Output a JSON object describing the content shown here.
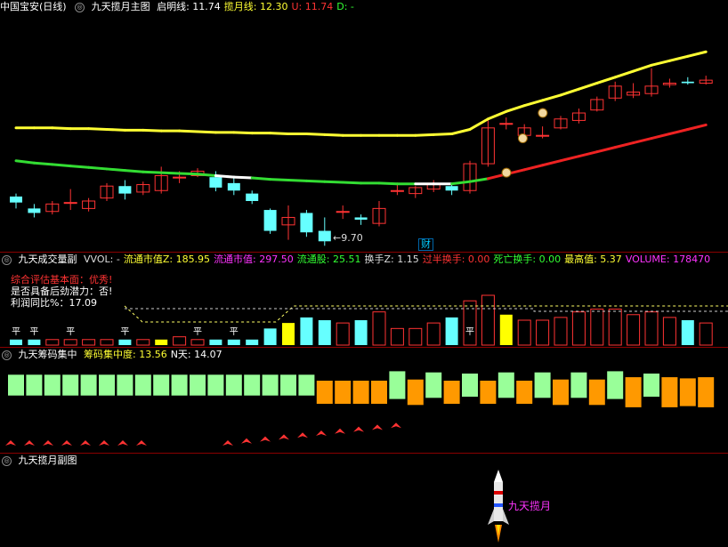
{
  "main": {
    "title": "中国宝安(日线)",
    "indicator": "九天揽月主图",
    "fields": [
      {
        "label": "启明线:",
        "value": "11.74",
        "color": "#ffffff"
      },
      {
        "label": "揽月线:",
        "value": "12.30",
        "color": "#ffff33"
      },
      {
        "label": "U:",
        "value": "11.74",
        "color": "#ff3333"
      },
      {
        "label": "D:",
        "value": "-",
        "color": "#33ff33"
      }
    ],
    "low_label": "9.70",
    "cai_label": "财"
  },
  "vol": {
    "indicator": "九天成交量副",
    "fields": [
      {
        "label": "VVOL:",
        "value": "-",
        "color": "#dddddd"
      },
      {
        "label": "流通市值Z:",
        "value": "185.95",
        "color": "#ffff33"
      },
      {
        "label": "流通市值:",
        "value": "297.50",
        "color": "#ff33ff"
      },
      {
        "label": "流通股:",
        "value": "25.51",
        "color": "#33ff33"
      },
      {
        "label": "换手Z:",
        "value": "1.15",
        "color": "#dddddd"
      },
      {
        "label": "过半换手:",
        "value": "0.00",
        "color": "#ff3333"
      },
      {
        "label": "死亡换手:",
        "value": "0.00",
        "color": "#33ff33"
      },
      {
        "label": "最高值:",
        "value": "5.37",
        "color": "#ffff33"
      },
      {
        "label": "VOLUME:",
        "value": "178470",
        "color": "#ff33ff"
      }
    ],
    "notes": [
      {
        "text": "综合评估基本面：优秀!",
        "color": "#ff3333"
      },
      {
        "text": "是否具备后劲潜力：否!",
        "color": "#ffffff"
      },
      {
        "text": "利润同比%：17.09",
        "color": "#ffffff"
      }
    ],
    "ping": "平"
  },
  "chip": {
    "indicator": "九天筹码集中",
    "fields": [
      {
        "label": "筹码集中度:",
        "value": "13.56",
        "color": "#ffff33"
      },
      {
        "label": "N天:",
        "value": "14.07",
        "color": "#ffffff"
      }
    ]
  },
  "moon": {
    "indicator": "九天揽月副图",
    "rocket_label": "九天揽月"
  },
  "chart_data": {
    "type": "candlestick",
    "candles": [
      [
        11.48,
        11.4,
        11.52,
        11.32
      ],
      [
        11.32,
        11.26,
        11.38,
        11.2
      ],
      [
        11.28,
        11.38,
        11.42,
        11.24
      ],
      [
        11.4,
        11.4,
        11.58,
        11.3
      ],
      [
        11.32,
        11.42,
        11.46,
        11.28
      ],
      [
        11.46,
        11.62,
        11.66,
        11.42
      ],
      [
        11.62,
        11.52,
        11.7,
        11.44
      ],
      [
        11.54,
        11.64,
        11.68,
        11.5
      ],
      [
        11.56,
        11.76,
        11.88,
        11.52
      ],
      [
        11.74,
        11.74,
        11.82,
        11.66
      ],
      [
        11.76,
        11.82,
        11.86,
        11.74
      ],
      [
        11.74,
        11.6,
        11.82,
        11.55
      ],
      [
        11.66,
        11.56,
        11.74,
        11.5
      ],
      [
        11.52,
        11.42,
        11.56,
        11.38
      ],
      [
        11.3,
        11.02,
        11.32,
        10.98
      ],
      [
        11.1,
        11.2,
        11.36,
        10.9
      ],
      [
        11.26,
        11.0,
        11.3,
        10.94
      ],
      [
        11.02,
        10.88,
        11.2,
        10.82
      ],
      [
        11.28,
        11.28,
        11.36,
        11.18
      ],
      [
        11.2,
        11.17,
        11.24,
        11.1
      ],
      [
        11.12,
        11.32,
        11.42,
        11.08
      ],
      [
        11.56,
        11.56,
        11.66,
        11.5
      ],
      [
        11.52,
        11.6,
        11.62,
        11.46
      ],
      [
        11.58,
        11.64,
        11.7,
        11.54
      ],
      [
        11.62,
        11.56,
        11.66,
        11.5
      ],
      [
        11.56,
        11.92,
        11.96,
        11.52
      ],
      [
        11.92,
        12.4,
        12.5,
        11.88
      ],
      [
        12.46,
        12.46,
        12.54,
        12.38
      ],
      [
        12.3,
        12.4,
        12.45,
        12.28
      ],
      [
        12.3,
        12.3,
        12.42,
        12.26
      ],
      [
        12.4,
        12.52,
        12.56,
        12.38
      ],
      [
        12.5,
        12.6,
        12.66,
        12.46
      ],
      [
        12.64,
        12.78,
        12.82,
        12.62
      ],
      [
        12.8,
        12.96,
        13.02,
        12.76
      ],
      [
        12.84,
        12.88,
        13.0,
        12.8
      ],
      [
        12.86,
        12.96,
        13.2,
        12.82
      ],
      [
        12.98,
        13.0,
        13.06,
        12.94
      ],
      [
        13.02,
        13.0,
        13.08,
        12.98
      ],
      [
        13.0,
        13.04,
        13.1,
        12.98
      ]
    ],
    "qiming_line": [
      12.4,
      12.4,
      12.4,
      12.39,
      12.39,
      12.38,
      12.37,
      12.37,
      12.36,
      12.36,
      12.35,
      12.34,
      12.34,
      12.33,
      12.33,
      12.32,
      12.32,
      12.31,
      12.3,
      12.3,
      12.3,
      12.3,
      12.3,
      12.31,
      12.32,
      12.38,
      12.52,
      12.62,
      12.7,
      12.77,
      12.84,
      12.92,
      13.0,
      13.08,
      13.16,
      13.24,
      13.3,
      13.36,
      13.42
    ],
    "lanyue_line": [
      11.96,
      11.93,
      11.91,
      11.89,
      11.87,
      11.85,
      11.83,
      11.81,
      11.8,
      11.79,
      11.78,
      11.76,
      11.74,
      11.73,
      11.71,
      11.7,
      11.69,
      11.68,
      11.67,
      11.66,
      11.66,
      11.65,
      11.65,
      11.65,
      11.65,
      11.68,
      11.72,
      11.78,
      11.84,
      11.9,
      11.96,
      12.02,
      12.08,
      12.14,
      12.2,
      12.26,
      12.32,
      12.38,
      12.44
    ],
    "volume": [
      2,
      2,
      2,
      2,
      2,
      2,
      2,
      2,
      2,
      3,
      2,
      2,
      2,
      2,
      6,
      8,
      10,
      9,
      8,
      9,
      12,
      6,
      6,
      8,
      10,
      16,
      18,
      11,
      9,
      9,
      10,
      12,
      13,
      13,
      11,
      12,
      10,
      9,
      8
    ],
    "chip_concentration": [
      0.9,
      0.9,
      0.9,
      0.9,
      0.9,
      0.9,
      0.9,
      0.9,
      0.9,
      0.9,
      0.9,
      0.9,
      0.9,
      0.9,
      0.9,
      0.9,
      0.9,
      1.0,
      1.0,
      1.0,
      1.0,
      1.2,
      1.1,
      1.1,
      1.0,
      1.0,
      1.0,
      1.1,
      1.0,
      1.1,
      1.1,
      1.1,
      1.1,
      1.2,
      1.3,
      1.0,
      1.3,
      1.2,
      1.3
    ],
    "ylim": [
      10.8,
      13.9
    ]
  }
}
